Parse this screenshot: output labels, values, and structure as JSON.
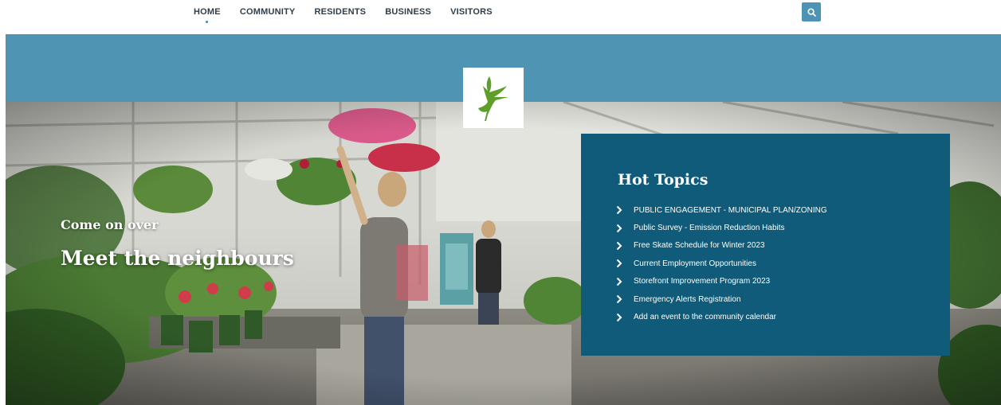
{
  "nav": {
    "items": [
      {
        "label": "HOME",
        "active": true
      },
      {
        "label": "COMMUNITY"
      },
      {
        "label": "RESIDENTS"
      },
      {
        "label": "BUSINESS"
      },
      {
        "label": "VISITORS"
      }
    ],
    "search_icon": "search-icon"
  },
  "hero": {
    "subtitle": "Come on over",
    "title": "Meet the neighbours",
    "logo_icon": "heron-icon"
  },
  "hot_topics": {
    "title": "Hot Topics",
    "items": [
      "PUBLIC ENGAGEMENT - MUNICIPAL PLAN/ZONING",
      "Public Survey - Emission Reduction Habits",
      "Free Skate Schedule for Winter 2023",
      "Current Employment Opportunities",
      "Storefront Improvement Program 2023",
      "Emergency Alerts Registration",
      "Add an event to the community calendar"
    ],
    "bullet_icon": "chevron-right-icon"
  },
  "colors": {
    "band": "#4f94b3",
    "panel": "#0f5b79",
    "search_button": "#4c93b5",
    "logo_green": "#5f9e2b"
  }
}
